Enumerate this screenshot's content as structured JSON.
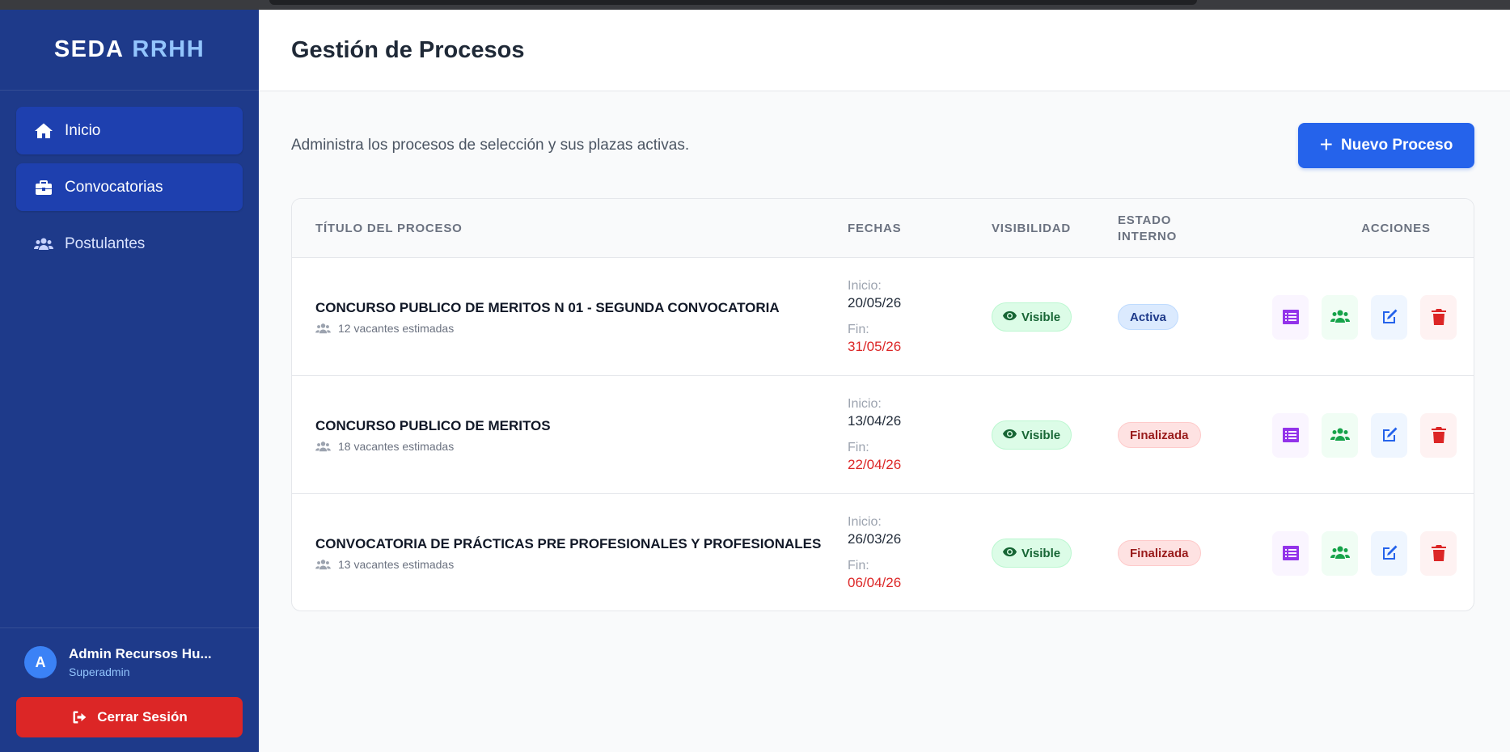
{
  "brand": {
    "part1": "SEDA",
    "part2": "RRHH"
  },
  "sidebar": {
    "items": [
      {
        "label": "Inicio",
        "icon": "home-icon"
      },
      {
        "label": "Convocatorias",
        "icon": "briefcase-icon"
      },
      {
        "label": "Postulantes",
        "icon": "users-icon"
      }
    ]
  },
  "user": {
    "initial": "A",
    "name": "Admin Recursos Hu...",
    "role": "Superadmin",
    "logout_label": "Cerrar Sesión"
  },
  "header": {
    "title": "Gestión de Procesos"
  },
  "main": {
    "subtitle": "Administra los procesos de selección y sus plazas activas.",
    "new_button": "Nuevo Proceso",
    "new_button_icon": "+"
  },
  "table": {
    "headers": {
      "title": "Título del Proceso",
      "dates": "Fechas",
      "visibility": "Visibilidad",
      "state": "Estado Interno",
      "actions": "Acciones"
    },
    "rows": [
      {
        "title": "CONCURSO PUBLICO DE MERITOS N 01 - SEGUNDA CONVOCATORIA",
        "vacancies": "12 vacantes estimadas",
        "start_label": "Inicio:",
        "start": "20/05/26",
        "end_label": "Fin:",
        "end": "31/05/26",
        "visibility": "Visible",
        "state": "Activa"
      },
      {
        "title": "CONCURSO PUBLICO DE MERITOS",
        "vacancies": "18 vacantes estimadas",
        "start_label": "Inicio:",
        "start": "13/04/26",
        "end_label": "Fin:",
        "end": "22/04/26",
        "visibility": "Visible",
        "state": "Finalizada"
      },
      {
        "title": "CONVOCATORIA DE PRÁCTICAS PRE PROFESIONALES Y PROFESIONALES",
        "vacancies": "13 vacantes estimadas",
        "start_label": "Inicio:",
        "start": "26/03/26",
        "end_label": "Fin:",
        "end": "06/04/26",
        "visibility": "Visible",
        "state": "Finalizada"
      }
    ]
  },
  "colors": {
    "sidebar": "#1e3a8a",
    "accent": "#2563eb",
    "danger": "#dc2626",
    "success": "#16a34a",
    "purple": "#9333ea"
  }
}
